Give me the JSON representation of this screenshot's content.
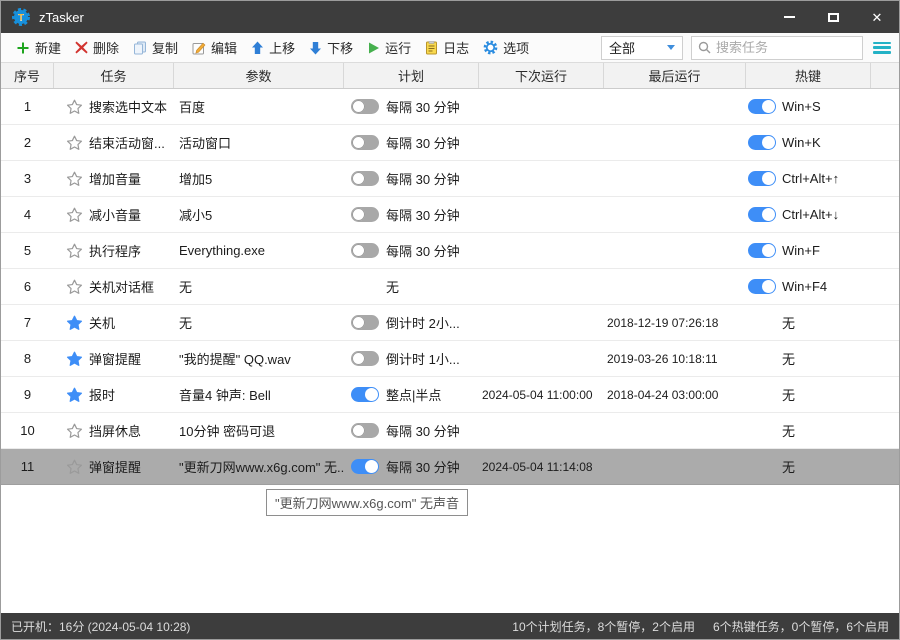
{
  "titlebar": {
    "title": "zTasker",
    "controls": [
      "minimize",
      "maximize",
      "close"
    ]
  },
  "toolbar": {
    "buttons": [
      {
        "icon": "plus-icon",
        "label": "新建"
      },
      {
        "icon": "delete-icon",
        "label": "删除"
      },
      {
        "icon": "copy-icon",
        "label": "复制"
      },
      {
        "icon": "edit-icon",
        "label": "编辑"
      },
      {
        "icon": "up-icon",
        "label": "上移"
      },
      {
        "icon": "down-icon",
        "label": "下移"
      },
      {
        "icon": "run-icon",
        "label": "运行"
      },
      {
        "icon": "log-icon",
        "label": "日志"
      },
      {
        "icon": "gear-icon",
        "label": "选项"
      }
    ],
    "filter_value": "全部",
    "search_placeholder": "搜索任务"
  },
  "table": {
    "columns": [
      "序号",
      "任务",
      "参数",
      "计划",
      "下次运行",
      "最后运行",
      "热键",
      ""
    ],
    "rows": [
      {
        "no": "1",
        "starred": false,
        "task": "搜索选中文本",
        "params": "百度",
        "schedule_enabled": false,
        "schedule": "每隔 30 分钟",
        "next_run": "",
        "last_run": "",
        "hotkey_enabled": true,
        "hotkey": "Win+S",
        "selected": false
      },
      {
        "no": "2",
        "starred": false,
        "task": "结束活动窗...",
        "params": "活动窗口",
        "schedule_enabled": false,
        "schedule": "每隔 30 分钟",
        "next_run": "",
        "last_run": "",
        "hotkey_enabled": true,
        "hotkey": "Win+K",
        "selected": false
      },
      {
        "no": "3",
        "starred": false,
        "task": "增加音量",
        "params": "增加5",
        "schedule_enabled": false,
        "schedule": "每隔 30 分钟",
        "next_run": "",
        "last_run": "",
        "hotkey_enabled": true,
        "hotkey": "Ctrl+Alt+↑",
        "selected": false
      },
      {
        "no": "4",
        "starred": false,
        "task": "减小音量",
        "params": "减小5",
        "schedule_enabled": false,
        "schedule": "每隔 30 分钟",
        "next_run": "",
        "last_run": "",
        "hotkey_enabled": true,
        "hotkey": "Ctrl+Alt+↓",
        "selected": false
      },
      {
        "no": "5",
        "starred": false,
        "task": "执行程序",
        "params": "Everything.exe",
        "schedule_enabled": false,
        "schedule": "每隔 30 分钟",
        "next_run": "",
        "last_run": "",
        "hotkey_enabled": true,
        "hotkey": "Win+F",
        "selected": false
      },
      {
        "no": "6",
        "starred": false,
        "task": "关机对话框",
        "params": "无",
        "schedule_enabled": null,
        "schedule": "无",
        "next_run": "",
        "last_run": "",
        "hotkey_enabled": true,
        "hotkey": "Win+F4",
        "selected": false
      },
      {
        "no": "7",
        "starred": true,
        "task": "关机",
        "params": "无",
        "schedule_enabled": false,
        "schedule": "倒计时 2小...",
        "next_run": "",
        "last_run": "2018-12-19 07:26:18",
        "hotkey_enabled": null,
        "hotkey": "无",
        "selected": false
      },
      {
        "no": "8",
        "starred": true,
        "task": "弹窗提醒",
        "params": "\"我的提醒\" QQ.wav",
        "schedule_enabled": false,
        "schedule": "倒计时 1小...",
        "next_run": "",
        "last_run": "2019-03-26 10:18:11",
        "hotkey_enabled": null,
        "hotkey": "无",
        "selected": false
      },
      {
        "no": "9",
        "starred": true,
        "task": "报时",
        "params": "音量4 钟声: Bell",
        "schedule_enabled": true,
        "schedule": "整点|半点",
        "next_run": "2024-05-04 11:00:00",
        "last_run": "2018-04-24 03:00:00",
        "hotkey_enabled": null,
        "hotkey": "无",
        "selected": false
      },
      {
        "no": "10",
        "starred": false,
        "task": "挡屏休息",
        "params": "10分钟 密码可退",
        "schedule_enabled": false,
        "schedule": "每隔 30 分钟",
        "next_run": "",
        "last_run": "",
        "hotkey_enabled": null,
        "hotkey": "无",
        "selected": false
      },
      {
        "no": "11",
        "starred": false,
        "task": "弹窗提醒",
        "params": "\"更新刀网www.x6g.com\" 无...",
        "schedule_enabled": true,
        "schedule": "每隔 30 分钟",
        "next_run": "2024-05-04 11:14:08",
        "last_run": "",
        "hotkey_enabled": null,
        "hotkey": "无",
        "selected": true
      }
    ]
  },
  "tooltip": {
    "text": "\"更新刀网www.x6g.com\" 无声音"
  },
  "statusbar": {
    "left": "已开机：16分 (2024-05-04 10:28)",
    "plan_summary": "10个计划任务，8个暂停，2个启用",
    "hotkey_summary": "6个热键任务，0个暂停，6个启用"
  },
  "colors": {
    "accent_blue": "#3e8ef7",
    "toggle_off_gray": "#a8a8a8",
    "selected_row_gray": "#ababab",
    "titlebar_dark": "#3d3d3d",
    "list_icon_teal": "#24b2c6",
    "new_green": "#1ea51e",
    "delete_red": "#d23430",
    "run_green": "#46b04e"
  }
}
